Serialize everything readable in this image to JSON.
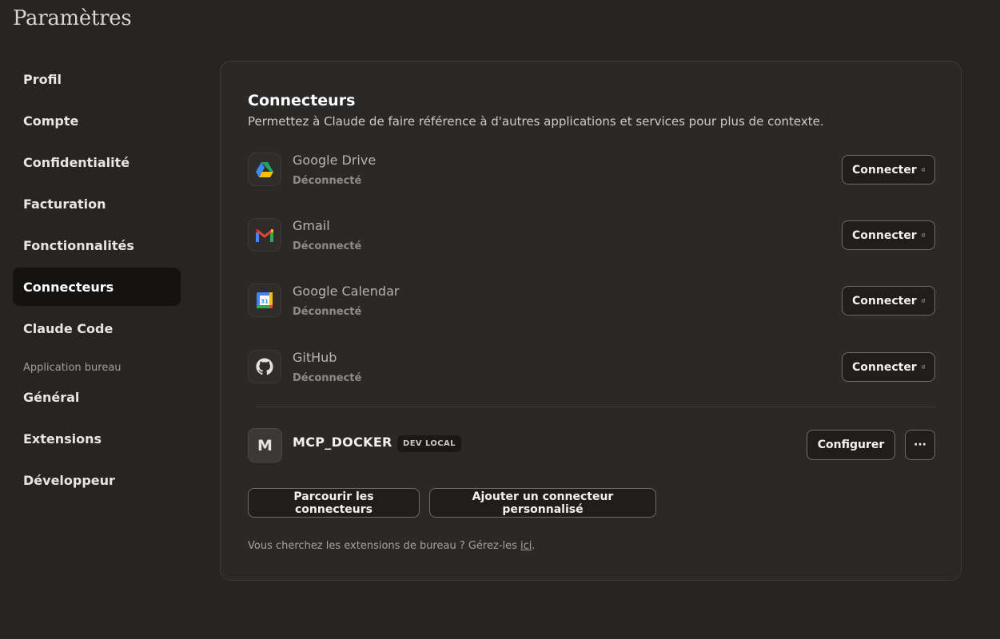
{
  "page": {
    "title": "Paramètres"
  },
  "sidebar": {
    "items": [
      {
        "label": "Profil"
      },
      {
        "label": "Compte"
      },
      {
        "label": "Confidentialité"
      },
      {
        "label": "Facturation"
      },
      {
        "label": "Fonctionnalités"
      },
      {
        "label": "Connecteurs",
        "active": true
      },
      {
        "label": "Claude Code"
      }
    ],
    "section_label": "Application bureau",
    "desktop_items": [
      {
        "label": "Général"
      },
      {
        "label": "Extensions"
      },
      {
        "label": "Développeur"
      }
    ]
  },
  "panel": {
    "title": "Connecteurs",
    "description": "Permettez à Claude de faire référence à d'autres applications et services pour plus de contexte.",
    "connectors": [
      {
        "name": "Google Drive",
        "status": "Déconnecté",
        "button": "Connecter",
        "icon": "google-drive-icon"
      },
      {
        "name": "Gmail",
        "status": "Déconnecté",
        "button": "Connecter",
        "icon": "gmail-icon"
      },
      {
        "name": "Google Calendar",
        "status": "Déconnecté",
        "button": "Connecter",
        "icon": "google-calendar-icon"
      },
      {
        "name": "GitHub",
        "status": "Déconnecté",
        "button": "Connecter",
        "icon": "github-icon"
      }
    ],
    "custom": {
      "avatar_letter": "M",
      "name": "MCP_DOCKER",
      "badge": "DEV LOCAL",
      "configure_label": "Configurer",
      "more_label": "···"
    },
    "browse_label": "Parcourir les connecteurs",
    "add_label": "Ajouter un connecteur personnalisé",
    "footer_text": "Vous cherchez les extensions de bureau ? Gérez-les ",
    "footer_link": "ici",
    "footer_end": "."
  },
  "colors": {
    "background": "#262524",
    "panel": "#2a2928",
    "active_nav": "#141312"
  }
}
